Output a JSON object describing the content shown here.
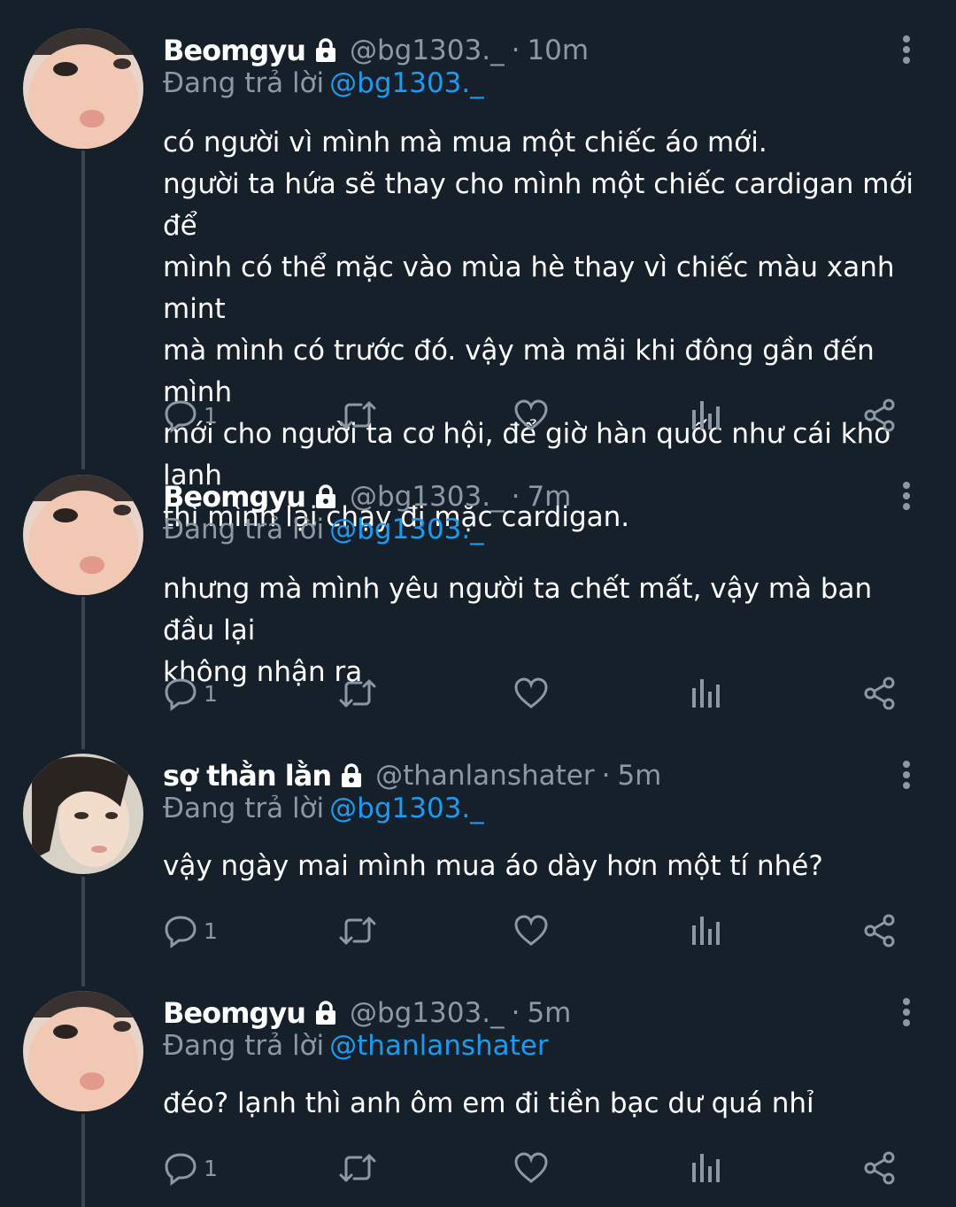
{
  "colors": {
    "background": "#15202b",
    "mention": "#1d9bf0",
    "secondary": "#8b98a5",
    "thread_line": "#3a4451"
  },
  "tweets": [
    {
      "name": "Beomgyu",
      "handle": "@bg1303._",
      "separator": "·",
      "time": "10m",
      "reply_label": "Đang trả lời",
      "reply_to": "@bg1303._",
      "text": "có người vì mình mà mua một chiếc áo mới.\nngười ta hứa sẽ thay cho mình một chiếc cardigan mới để\nmình có thể mặc vào mùa hè thay vì chiếc màu xanh mint\nmà mình có trước đó. vậy mà mãi khi đông gần đến mình\nmới cho người ta cơ hội, để giờ hàn quốc như cái kho lạnh\nthì mình lại chạy đi mặc cardigan.",
      "reply_count": "1",
      "icons": [
        "lock-icon",
        "more-icon",
        "reply-icon",
        "retweet-icon",
        "like-icon",
        "analytics-icon",
        "share-icon"
      ]
    },
    {
      "name": "Beomgyu",
      "handle": "@bg1303._",
      "separator": "·",
      "time": "7m",
      "reply_label": "Đang trả lời",
      "reply_to": "@bg1303._",
      "text": "nhưng mà mình yêu người ta chết mất, vậy mà ban đầu lại\nkhông nhận ra",
      "reply_count": "1"
    },
    {
      "name": "sợ thằn lằn",
      "handle": "@thanlanshater",
      "separator": "·",
      "time": "5m",
      "reply_label": "Đang trả lời",
      "reply_to": "@bg1303._",
      "text": "vậy ngày mai mình mua áo dày hơn một tí nhé?",
      "reply_count": "1"
    },
    {
      "name": "Beomgyu",
      "handle": "@bg1303._",
      "separator": "·",
      "time": "5m",
      "reply_label": "Đang trả lời",
      "reply_to": "@thanlanshater",
      "text": "đéo? lạnh thì anh ôm em đi tiền bạc dư quá nhỉ",
      "reply_count": "1"
    }
  ]
}
